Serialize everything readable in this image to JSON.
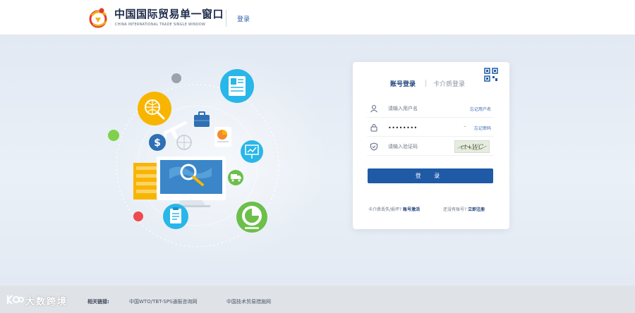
{
  "header": {
    "logo_cn": "中国国际贸易单一窗口",
    "logo_en": "CHINA INTERNATIONAL TRADE SINGLE WINDOW",
    "login_link": "登录"
  },
  "login": {
    "tab_account": "账号登录",
    "tab_card": "卡介质登录",
    "username_placeholder": "请输入用户名",
    "forgot_username": "忘记用户名",
    "password_value": "••••••••",
    "eye_glyph": "⌣",
    "forgot_password": "忘记密码",
    "captcha_placeholder": "请输入验证码",
    "captcha_text": "ct+WC",
    "submit": "登 录",
    "card_lost_text": "卡介质丢失/损坏?",
    "account_activate": "账号激活",
    "no_account_text": "还没有账号?",
    "register": "立即注册"
  },
  "illustration": {
    "icons": [
      "globe-search-icon",
      "document-icon",
      "dollar-icon",
      "briefcase-icon",
      "airplane-icon",
      "pie-chart-icon",
      "presentation-icon",
      "truck-icon",
      "clipboard-icon",
      "monitor-search-icon"
    ]
  },
  "footer": {
    "watermark": "大数跨境",
    "links_label": "相关链接:",
    "link_1": "中国WTO/TBT-SPS通报咨询网",
    "link_2": "中国技术贸易措施网"
  },
  "colors": {
    "primary": "#1f5aa6",
    "orange": "#f8b500",
    "cyan": "#29b6e8",
    "green": "#6bbf4a",
    "red": "#e5484d"
  }
}
